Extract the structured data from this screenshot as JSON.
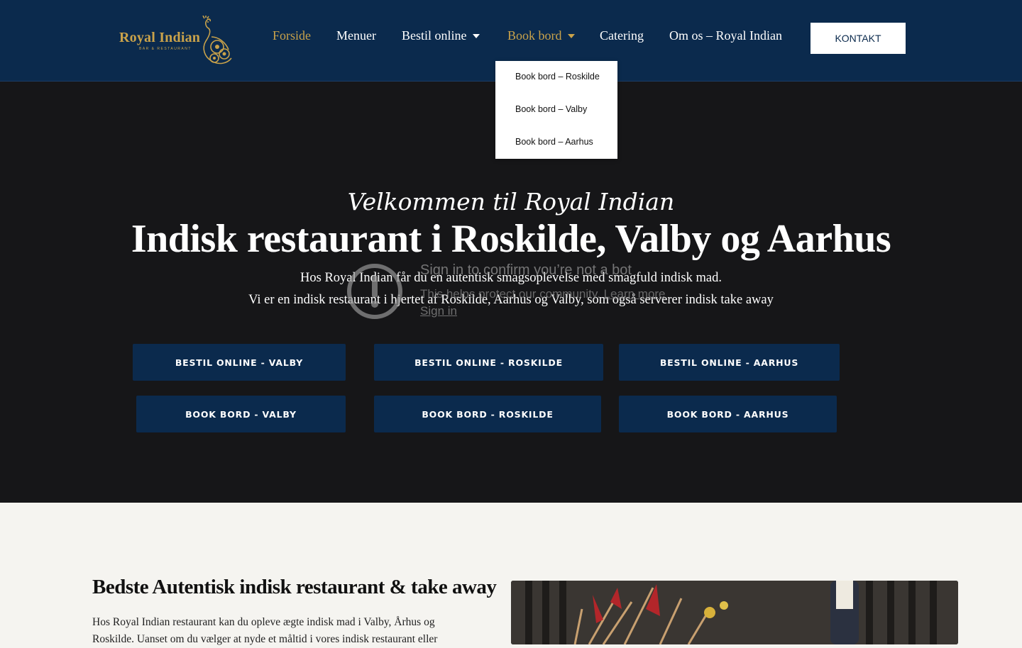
{
  "header": {
    "logo": {
      "name": "Royal Indian",
      "tagline": "BAR & RESTAURANT"
    },
    "nav": [
      {
        "label": "Forside",
        "active": true
      },
      {
        "label": "Menuer"
      },
      {
        "label": "Bestil online",
        "has_dropdown": true
      },
      {
        "label": "Book bord",
        "has_dropdown": true,
        "open": true
      },
      {
        "label": "Catering"
      },
      {
        "label": "Om os – Royal Indian"
      }
    ],
    "cta": "KONTAKT",
    "dropdown": [
      "Book bord – Roskilde",
      "Book bord – Valby",
      "Book bord – Aarhus"
    ]
  },
  "hero": {
    "script_title": "Velkommen til Royal Indian",
    "title": "Indisk restaurant i Roskilde, Valby og Aarhus",
    "line1": "Hos Royal Indian får du en autentisk smagsoplevelse med smagfuld indisk mad.",
    "line2": "Vi er en indisk restaurant i hjertet af Roskilde, Aarhus og Valby, som også serverer indisk take away",
    "buttons_row1": [
      "BESTIL ONLINE - VALBY",
      "BESTIL ONLINE - ROSKILDE",
      "BESTIL ONLINE - AARHUS"
    ],
    "buttons_row2": [
      "BOOK BORD - VALBY",
      "BOOK BORD - ROSKILDE",
      "BOOK BORD - AARHUS"
    ]
  },
  "bot_check": {
    "title": "Sign in to confirm you’re not a bot",
    "subtitle": "This helps protect our community.",
    "learn_more": "Learn more",
    "sign_in": "Sign in"
  },
  "section": {
    "title": "Bedste Autentisk indisk restaurant & take away",
    "text": "Hos Royal Indian restaurant kan du opleve ægte indisk mad i Valby, Århus og Roskilde. Uanset om du vælger at nyde et måltid i vores indisk restaurant eller"
  },
  "colors": {
    "navy": "#0b2a4d",
    "gold": "#c9a24a",
    "hero_bg": "#161618",
    "page_bg": "#f5f4f0"
  }
}
